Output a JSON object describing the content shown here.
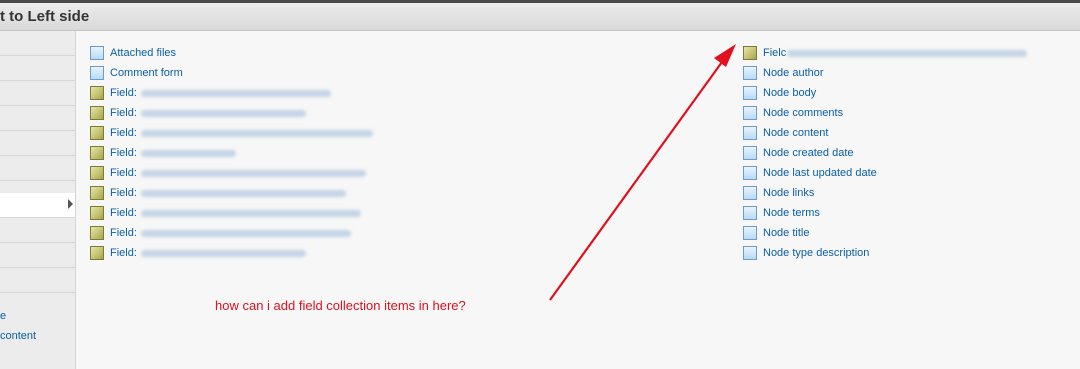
{
  "header": {
    "title": "t to Left side"
  },
  "sidebar": {
    "links": [
      "e",
      "content"
    ]
  },
  "left_list": [
    {
      "label": "Attached files",
      "icon": "doc"
    },
    {
      "label": "Comment form",
      "icon": "doc"
    },
    {
      "label": "Field:",
      "icon": "cube"
    },
    {
      "label": "Field:",
      "icon": "cube"
    },
    {
      "label": "Field:",
      "icon": "cube"
    },
    {
      "label": "Field:",
      "icon": "cube"
    },
    {
      "label": "Field:",
      "icon": "cube"
    },
    {
      "label": "Field:",
      "icon": "cube"
    },
    {
      "label": "Field:",
      "icon": "cube"
    },
    {
      "label": "Field:",
      "icon": "cube"
    },
    {
      "label": "Field:",
      "icon": "cube"
    }
  ],
  "right_list": [
    {
      "label": "Fielc",
      "icon": "cube"
    },
    {
      "label": "Node author",
      "icon": "doc"
    },
    {
      "label": "Node body",
      "icon": "doc"
    },
    {
      "label": "Node comments",
      "icon": "doc"
    },
    {
      "label": "Node content",
      "icon": "doc"
    },
    {
      "label": "Node created date",
      "icon": "doc"
    },
    {
      "label": "Node last updated date",
      "icon": "doc"
    },
    {
      "label": "Node links",
      "icon": "doc"
    },
    {
      "label": "Node terms",
      "icon": "doc"
    },
    {
      "label": "Node title",
      "icon": "doc"
    },
    {
      "label": "Node type description",
      "icon": "doc"
    }
  ],
  "annotation": {
    "text": "how can i add field collection items in here?",
    "color": "#e0101e"
  },
  "colors": {
    "link": "#0b5fa6",
    "header_bg": "#e3e3e3"
  }
}
